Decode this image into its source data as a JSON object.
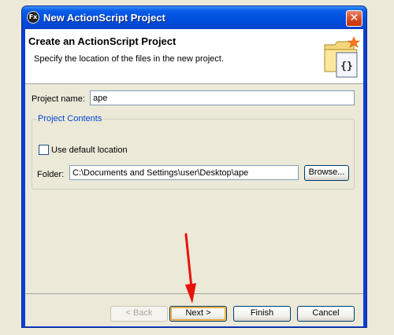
{
  "window": {
    "title": "New ActionScript Project",
    "app_icon_text": "Fx",
    "close_label": "✕"
  },
  "banner": {
    "title": "Create an ActionScript Project",
    "description": "Specify the location of the files in the new project.",
    "icon": "folder-actionscript-icon"
  },
  "form": {
    "project_name_label": "Project name:",
    "project_name_value": "ape",
    "group_title": "Project Contents",
    "use_default_location_label": "Use default location",
    "use_default_location_checked": false,
    "folder_label": "Folder:",
    "folder_value": "C:\\Documents and Settings\\user\\Desktop\\ape",
    "browse_label": "Browse..."
  },
  "buttons": {
    "back": "< Back",
    "next": "Next >",
    "finish": "Finish",
    "cancel": "Cancel"
  },
  "annotation": {
    "arrow_color": "#e8120c",
    "icon": "red-arrow-icon"
  }
}
